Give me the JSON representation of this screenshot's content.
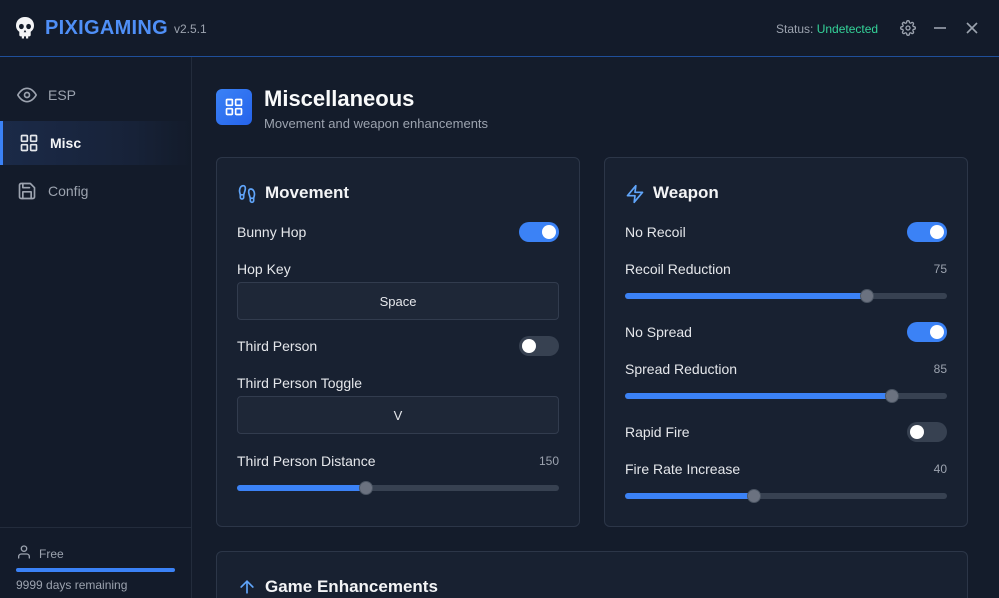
{
  "app": {
    "brand": "PIXIGAMING",
    "version": "v2.5.1",
    "status_label": "Status:",
    "status_value": "Undetected",
    "status_color": "#34d399",
    "accent_color": "#3b82f6"
  },
  "titlebar_icons": [
    "gear-icon",
    "minimize-icon",
    "close-icon"
  ],
  "sidebar": {
    "items": [
      {
        "label": "ESP",
        "icon": "eye-icon",
        "active": false
      },
      {
        "label": "Misc",
        "icon": "grid-icon",
        "active": true
      },
      {
        "label": "Config",
        "icon": "save-icon",
        "active": false
      }
    ],
    "plan": "Free",
    "days_remaining": "9999 days remaining",
    "plan_progress": 1.0
  },
  "page": {
    "title": "Miscellaneous",
    "subtitle": "Movement and weapon enhancements"
  },
  "movement": {
    "title": "Movement",
    "bunny_hop": {
      "label": "Bunny Hop",
      "on": true
    },
    "hop_key": {
      "label": "Hop Key",
      "value": "Space"
    },
    "third_person": {
      "label": "Third Person",
      "on": false
    },
    "third_person_toggle": {
      "label": "Third Person Toggle",
      "value": "V"
    },
    "third_person_distance": {
      "label": "Third Person Distance",
      "value": "150",
      "fraction": 0.4
    }
  },
  "weapon": {
    "title": "Weapon",
    "no_recoil": {
      "label": "No Recoil",
      "on": true
    },
    "recoil_reduction": {
      "label": "Recoil Reduction",
      "value": "75",
      "fraction": 0.75
    },
    "no_spread": {
      "label": "No Spread",
      "on": true
    },
    "spread_reduction": {
      "label": "Spread Reduction",
      "value": "85",
      "fraction": 0.83
    },
    "rapid_fire": {
      "label": "Rapid Fire",
      "on": false
    },
    "fire_rate_increase": {
      "label": "Fire Rate Increase",
      "value": "40",
      "fraction": 0.4
    }
  },
  "game_enhancements": {
    "title": "Game Enhancements"
  }
}
